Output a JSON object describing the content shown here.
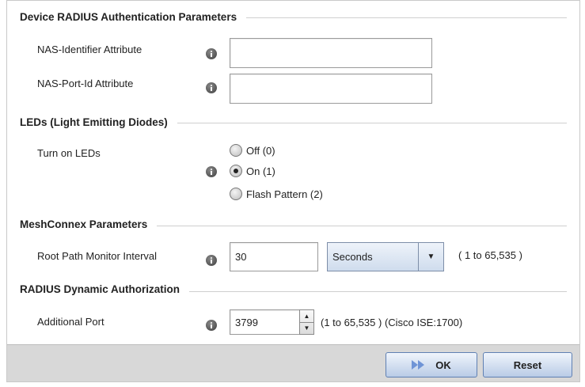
{
  "sections": {
    "radius": "Device RADIUS Authentication Parameters",
    "leds": "LEDs (Light Emitting Diodes)",
    "mesh": "MeshConnex Parameters",
    "dynamic": "RADIUS Dynamic Authorization"
  },
  "fields": {
    "nas_identifier": {
      "label": "NAS-Identifier Attribute",
      "value": ""
    },
    "nas_port_id": {
      "label": "NAS-Port-Id Attribute",
      "value": ""
    },
    "leds_label": "Turn on LEDs",
    "led_options": [
      "Off  (0)",
      "On  (1)",
      "Flash Pattern  (2)"
    ],
    "led_selected": 1,
    "root_path": {
      "label": "Root Path Monitor Interval",
      "value": "30",
      "unit": "Seconds",
      "range": "( 1 to 65,535 )"
    },
    "additional_port": {
      "label": "Additional Port",
      "value": "3799",
      "range": "(1 to 65,535 )  (Cisco ISE:1700)"
    }
  },
  "icons": {
    "info": "info-icon",
    "ok": "double-arrow-right-icon",
    "dropdown": "caret-down-icon"
  },
  "buttons": {
    "ok": "OK",
    "reset": "Reset"
  }
}
